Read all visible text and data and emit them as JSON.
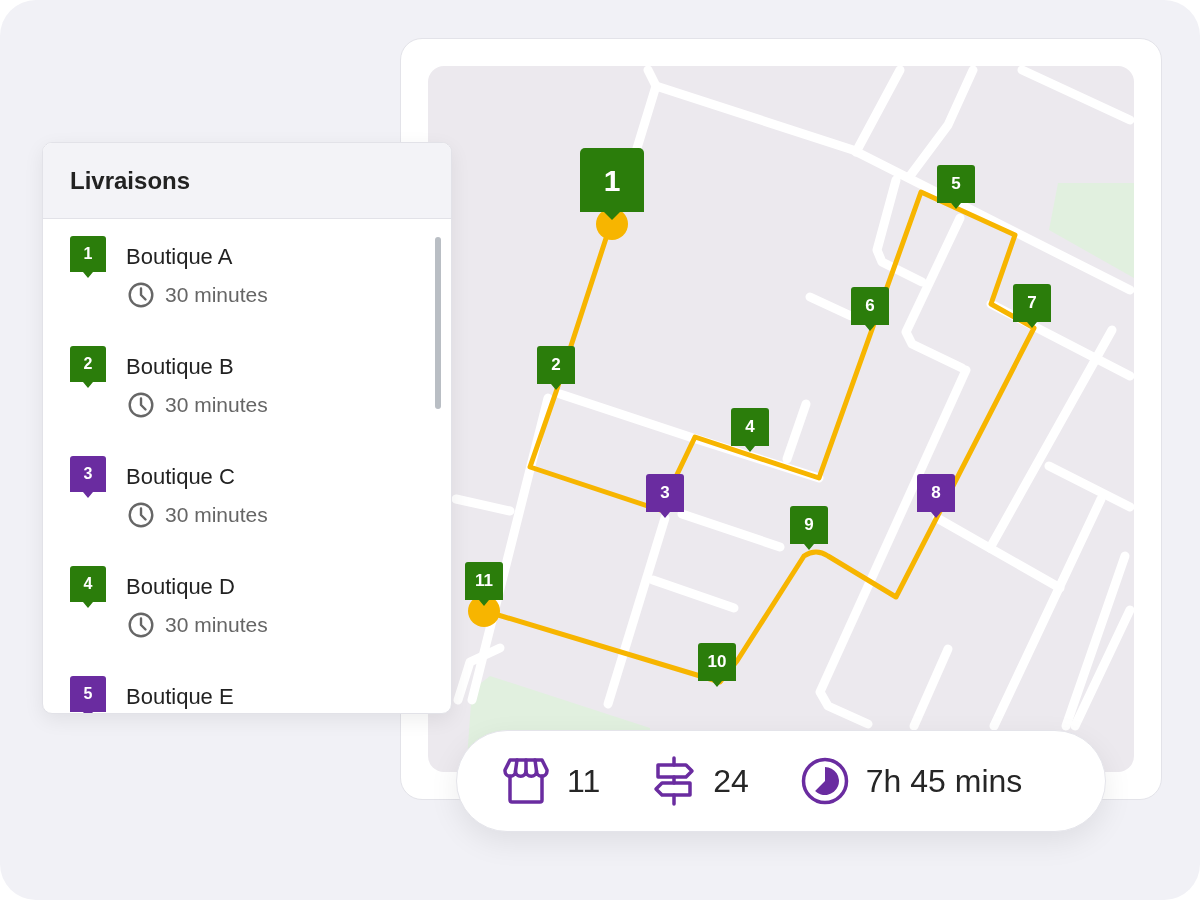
{
  "deliveries": {
    "title": "Livraisons",
    "items": [
      {
        "number": "1",
        "name": "Boutique A",
        "duration": "30 minutes",
        "color": "#2b7d0b"
      },
      {
        "number": "2",
        "name": "Boutique B",
        "duration": "30 minutes",
        "color": "#2b7d0b"
      },
      {
        "number": "3",
        "name": "Boutique C",
        "duration": "30 minutes",
        "color": "#6a2ca0"
      },
      {
        "number": "4",
        "name": "Boutique D",
        "duration": "30 minutes",
        "color": "#2b7d0b"
      },
      {
        "number": "5",
        "name": "Boutique E",
        "color": "#6a2ca0"
      }
    ]
  },
  "map": {
    "markers": [
      {
        "label": "1",
        "kind": "start",
        "color": "#2b7d0b"
      },
      {
        "label": "2",
        "kind": "stop",
        "color": "#2b7d0b"
      },
      {
        "label": "3",
        "kind": "stop",
        "color": "#6a2ca0"
      },
      {
        "label": "4",
        "kind": "stop",
        "color": "#2b7d0b"
      },
      {
        "label": "5",
        "kind": "stop",
        "color": "#2b7d0b"
      },
      {
        "label": "6",
        "kind": "stop",
        "color": "#2b7d0b"
      },
      {
        "label": "7",
        "kind": "stop",
        "color": "#2b7d0b"
      },
      {
        "label": "8",
        "kind": "stop",
        "color": "#6a2ca0"
      },
      {
        "label": "9",
        "kind": "stop",
        "color": "#2b7d0b"
      },
      {
        "label": "10",
        "kind": "stop",
        "color": "#2b7d0b"
      },
      {
        "label": "11",
        "kind": "end",
        "color": "#2b7d0b"
      }
    ]
  },
  "summary": [
    {
      "kind": "stores",
      "value": "11"
    },
    {
      "kind": "route",
      "value": "24"
    },
    {
      "kind": "time",
      "value": "7h 45 mins"
    }
  ]
}
